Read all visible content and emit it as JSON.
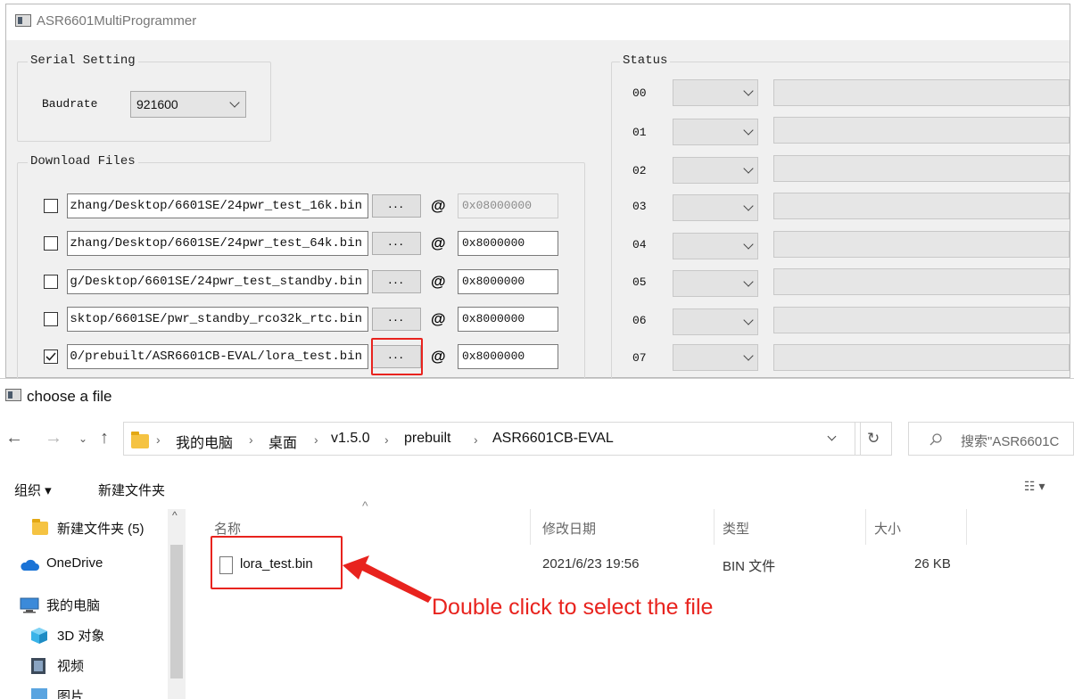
{
  "programmer": {
    "title": "ASR6601MultiProgrammer",
    "serial": {
      "legend": "Serial Setting",
      "baudrate_label": "Baudrate",
      "baudrate_value": "921600"
    },
    "download": {
      "legend": "Download Files",
      "browse_label": "...",
      "at_label": "@",
      "rows": [
        {
          "checked": false,
          "path": "zhang/Desktop/6601SE/24pwr_test_16k.bin",
          "address": "0x08000000",
          "address_enabled": false
        },
        {
          "checked": false,
          "path": "zhang/Desktop/6601SE/24pwr_test_64k.bin",
          "address": "0x8000000",
          "address_enabled": true
        },
        {
          "checked": false,
          "path": "g/Desktop/6601SE/24pwr_test_standby.bin",
          "address": "0x8000000",
          "address_enabled": true
        },
        {
          "checked": false,
          "path": "sktop/6601SE/pwr_standby_rco32k_rtc.bin",
          "address": "0x8000000",
          "address_enabled": true
        },
        {
          "checked": true,
          "path": "0/prebuilt/ASR6601CB-EVAL/lora_test.bin",
          "address": "0x8000000",
          "address_enabled": true
        }
      ]
    },
    "status": {
      "legend": "Status",
      "ports": [
        "00",
        "01",
        "02",
        "03",
        "04",
        "05",
        "06",
        "07"
      ]
    }
  },
  "dialog": {
    "title": "choose a file",
    "breadcrumb": [
      "我的电脑",
      "桌面",
      "v1.5.0",
      "prebuilt",
      "ASR6601CB-EVAL"
    ],
    "search_placeholder": "搜索\"ASR6601C",
    "toolbar": {
      "organize": "组织 ▾",
      "new_folder": "新建文件夹"
    },
    "nav": [
      {
        "label": "新建文件夹 (5)",
        "icon": "folder-icon"
      },
      {
        "label": "OneDrive",
        "icon": "onedrive-cloud-icon"
      },
      {
        "label": "我的电脑",
        "icon": "computer-icon"
      },
      {
        "label": "3D 对象",
        "icon": "3d-objects-icon"
      },
      {
        "label": "视频",
        "icon": "video-icon"
      },
      {
        "label": "图片",
        "icon": "pictures-icon"
      }
    ],
    "columns": {
      "name": "名称",
      "date": "修改日期",
      "type": "类型",
      "size": "大小"
    },
    "files": [
      {
        "name": "lora_test.bin",
        "date": "2021/6/23 19:56",
        "type": "BIN 文件",
        "size": "26 KB"
      }
    ],
    "annotation": "Double click to select the file"
  },
  "colors": {
    "highlight_red": "#e8231e",
    "window_bg": "#f0f0f0",
    "onedrive_blue": "#1a73d6"
  }
}
